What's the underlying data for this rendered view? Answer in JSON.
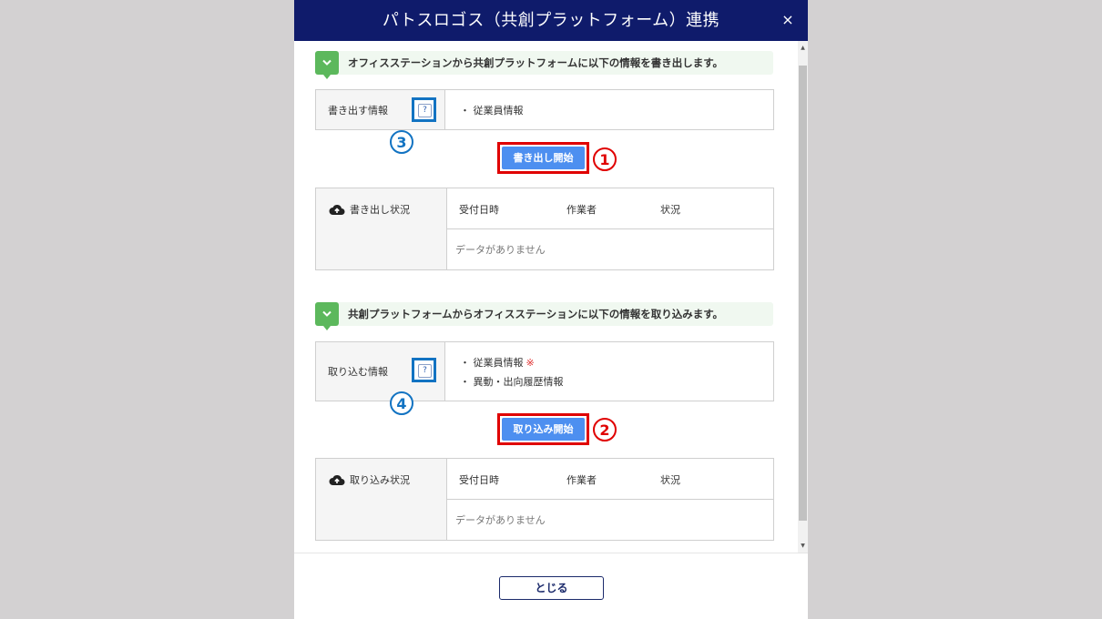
{
  "dialog": {
    "title": "パトスロゴス（共創プラットフォーム）連携",
    "close_icon_glyph": "×",
    "header_color": "#0f1b6b"
  },
  "export": {
    "banner_text": "オフィスステーションから共創プラットフォームに以下の情報を書き出します。",
    "info_label": "書き出す情報",
    "help_glyph": "?",
    "items": [
      "・ 従業員情報"
    ],
    "callout_help": "3",
    "start_button": "書き出し開始",
    "callout_button": "1",
    "status_label": "書き出し状況",
    "columns": [
      "受付日時",
      "作業者",
      "状況"
    ],
    "empty_text": "データがありません"
  },
  "import": {
    "banner_text": "共創プラットフォームからオフィスステーションに以下の情報を取り込みます。",
    "info_label": "取り込む情報",
    "help_glyph": "?",
    "items": [
      "・ 従業員情報",
      "・ 異動・出向履歴情報"
    ],
    "required_mark": "※",
    "callout_help": "4",
    "start_button": "取り込み開始",
    "callout_button": "2",
    "status_label": "取り込み状況",
    "columns": [
      "受付日時",
      "作業者",
      "状況"
    ],
    "empty_text": "データがありません"
  },
  "footer": {
    "close_button": "とじる"
  },
  "icons": {
    "banner": "chevron-down-icon",
    "status": "cloud-upload-icon",
    "help": "question-icon"
  },
  "colors": {
    "accent_button": "#4d8ff0",
    "highlight_red": "#e00000",
    "highlight_blue": "#1273c2",
    "banner_green": "#5cb85c"
  }
}
